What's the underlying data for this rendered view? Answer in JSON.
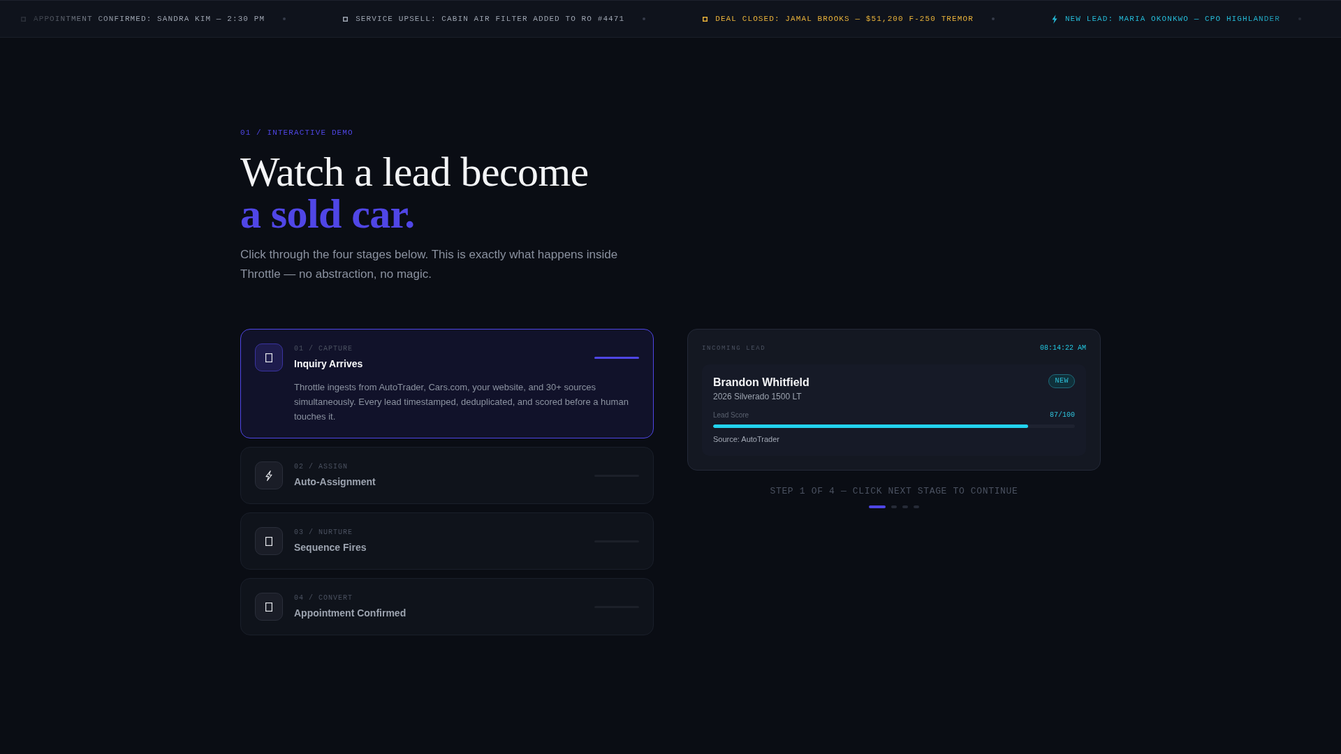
{
  "ticker": [
    {
      "kind": "box",
      "text": "APPOINTMENT CONFIRMED: SANDRA KIM — 2:30 PM",
      "color": "#9ca3af"
    },
    {
      "kind": "box",
      "text": "SERVICE UPSELL: CABIN AIR FILTER ADDED TO RO #4471",
      "color": "#9ca3af"
    },
    {
      "kind": "box",
      "text": "DEAL CLOSED: JAMAL BROOKS — $51,200 F-250 TREMOR",
      "color": "#e8b23a"
    },
    {
      "kind": "bolt",
      "text": "NEW LEAD: MARIA OKONKWO — CPO HIGHLANDER",
      "color": "#25b9d6"
    }
  ],
  "section": {
    "eyebrow": "01 / INTERACTIVE DEMO",
    "title": "Watch a lead become **a sold car.**",
    "subtitle": "Click through the four stages below. This is exactly what happens inside Throttle — no abstraction, no magic."
  },
  "steps": [
    {
      "kind": "box",
      "label": "01 / CAPTURE",
      "title": "Inquiry Arrives",
      "description": "Throttle ingests from AutoTrader, Cars.com, your website, and 30+ sources simultaneously. Every lead timestamped, deduplicated, and scored before a human touches it.",
      "selected": true
    },
    {
      "kind": "bolt",
      "label": "02 / ASSIGN",
      "title": "Auto-Assignment",
      "selected": false
    },
    {
      "kind": "box",
      "label": "03 / NURTURE",
      "title": "Sequence Fires",
      "selected": false
    },
    {
      "kind": "box",
      "label": "04 / CONVERT",
      "title": "Appointment Confirmed",
      "selected": false
    }
  ],
  "lead_panel": {
    "header": "INCOMING LEAD",
    "time": "08:14:22 AM",
    "lead": {
      "name": "Brandon Whitfield",
      "vehicle": "2026 Silverado 1500 LT",
      "badge": "NEW",
      "score_label": "Lead Score",
      "score": "87/100",
      "level": 0.87,
      "source": "Source: AutoTrader"
    }
  },
  "caption": "STEP 1 OF 4 — CLICK NEXT STAGE TO CONTINUE",
  "step_dots": [
    {
      "selected": true
    },
    {
      "selected": false
    },
    {
      "selected": false
    },
    {
      "selected": false
    }
  ]
}
